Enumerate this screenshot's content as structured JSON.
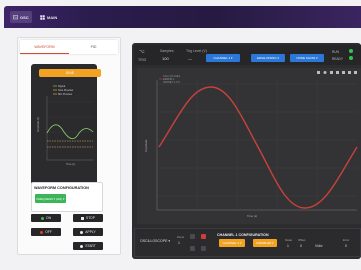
{
  "topbar": {
    "tabs": [
      {
        "label": "OSC",
        "icon": "oscilloscope-icon",
        "active": true
      },
      {
        "label": "MAIN",
        "icon": "grid-icon",
        "active": false
      }
    ]
  },
  "left": {
    "tabs": [
      {
        "label": "WAVEFORM"
      },
      {
        "label": "PID"
      }
    ],
    "wave_pill": "SINE",
    "small_chart": {
      "legend": [
        "Signal",
        "Sine Preview",
        "Min Preview"
      ],
      "xlabel": "Time (s)",
      "ylabel": "Amplitude (V)"
    },
    "waveform_config": {
      "title": "WAVEFORM CONFIGURATION",
      "frequency_button": "FREQUENCY (HZ) ▾"
    },
    "controls": [
      {
        "label": "ON",
        "dot": "#35c34e"
      },
      {
        "label": "STOP",
        "dot": "#e8e8e8"
      },
      {
        "label": "OFF",
        "dot": "#d8402e"
      },
      {
        "label": "APPLY",
        "dot": "#e8e8e8"
      },
      {
        "label": "START",
        "dot": "#e8e8e8"
      }
    ]
  },
  "right": {
    "header": {
      "trig": "TRIG",
      "samples_label": "Samples",
      "samples_value": "100",
      "trig_level_label": "Trig Level (V)",
      "trig_level_value": "—",
      "buttons": [
        "CHANNEL 1 ▾",
        "EDGE RISING ▾",
        "NONE SHOW ▾"
      ],
      "status": [
        {
          "label": "RUN"
        },
        {
          "label": "READY"
        }
      ]
    },
    "plot": {
      "legend": [
        "Ch1 (1.0 V/div)",
        "ERROR 1",
        "OFFSET 1.0 V"
      ],
      "xlabel": "Time (s)",
      "ylabel": "Amplitude"
    },
    "bottom": {
      "oscilloscope": "OSCILLOSCOPE ▾",
      "zoom_label": "Zoom",
      "zoom_value": "1",
      "channel_config": "CHANNEL 1 CONFIGURATION",
      "channel_button": "CHANNEL 1 ▾",
      "disabled_button": "DISABLED ▾",
      "scale_label": "Scale",
      "scale_value": "1",
      "offset_label": "Offset",
      "offset_value": "0",
      "unit": "V/div",
      "extra_label": "Error",
      "extra_value": "0"
    }
  },
  "colors": {
    "accent_orange": "#f2a322",
    "accent_blue": "#2b78d9",
    "status_green": "#35c34e",
    "signal_red": "#c9413b"
  }
}
